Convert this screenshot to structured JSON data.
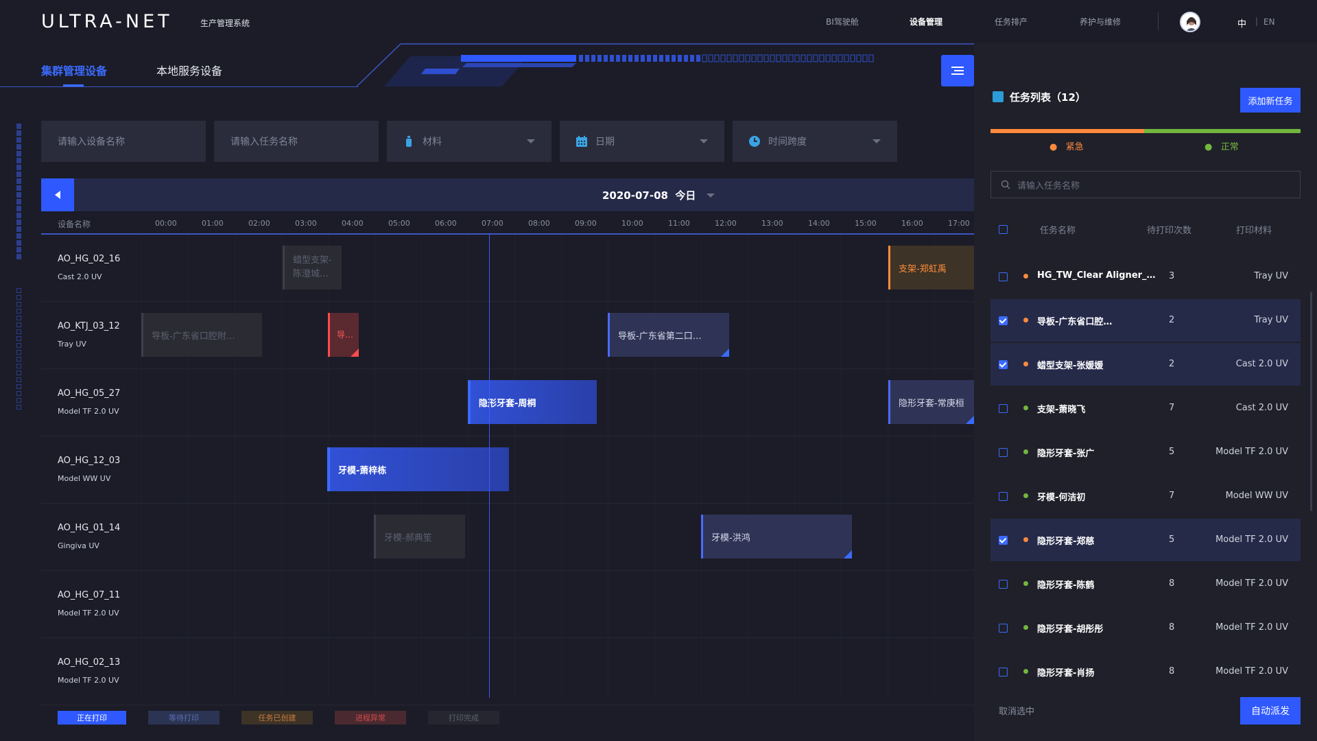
{
  "app": {
    "logo": "ULTRA-NET",
    "subtitle": "生产管理系统"
  },
  "topnav": [
    {
      "label": "BI驾驶舱"
    },
    {
      "label": "设备管理"
    },
    {
      "label": "任务排产"
    },
    {
      "label": "养护与维修"
    }
  ],
  "lang": {
    "zh": "中",
    "sep": "|",
    "en": "EN"
  },
  "tabs": [
    {
      "label": "集群管理设备"
    },
    {
      "label": "本地服务设备"
    }
  ],
  "filters": {
    "device_placeholder": "请输入设备名称",
    "task_placeholder": "请输入任务名称",
    "material": "材料",
    "date": "日期",
    "timespan": "时间跨度"
  },
  "datebar": {
    "date": "2020-07-08",
    "today": "今日"
  },
  "timeline": {
    "device_header": "设备名称",
    "hours": [
      "00:00",
      "01:00",
      "02:00",
      "03:00",
      "04:00",
      "05:00",
      "06:00",
      "07:00",
      "08:00",
      "09:00",
      "10:00",
      "11:00",
      "12:00",
      "13:00",
      "14:00",
      "15:00",
      "16:00",
      "17:00"
    ]
  },
  "devices": [
    {
      "name": "AO_HG_02_16",
      "type": "Cast 2.0 UV"
    },
    {
      "name": "AO_KTJ_03_12",
      "type": "Tray UV"
    },
    {
      "name": "AO_HG_05_27",
      "type": "Model TF 2.0 UV"
    },
    {
      "name": "AO_HG_12_03",
      "type": "Model WW UV"
    },
    {
      "name": "AO_HG_01_14",
      "type": "Gingiva UV"
    },
    {
      "name": "AO_HG_07_11",
      "type": "Model TF 2.0 UV"
    },
    {
      "name": "AO_HG_02_13",
      "type": "Model TF 2.0 UV"
    }
  ],
  "tasks": [
    {
      "label": "蜡型支架-陈澄城…",
      "status": "done"
    },
    {
      "label": "支架-郑虹禹",
      "status": "created"
    },
    {
      "label": "导板-广东省口腔附…",
      "status": "done"
    },
    {
      "label": "导…",
      "status": "error"
    },
    {
      "label": "导板-广东省第二口…",
      "status": "waiting"
    },
    {
      "label": "隐形牙套-周桐",
      "status": "printing"
    },
    {
      "label": "隐形牙套-常庚桓",
      "status": "waiting"
    },
    {
      "label": "牙模-萧梓栋",
      "status": "printing"
    },
    {
      "label": "牙模-郝典笙",
      "status": "done"
    },
    {
      "label": "牙模-洪鸿",
      "status": "waiting"
    }
  ],
  "legend": [
    {
      "label": "正在打印"
    },
    {
      "label": "等待打印"
    },
    {
      "label": "任务已创建"
    },
    {
      "label": "进程异常"
    },
    {
      "label": "打印完成"
    }
  ],
  "task_panel": {
    "title": "任务列表（12）",
    "add_button": "添加新任务",
    "urgent": "紧急",
    "normal": "正常",
    "search_placeholder": "请输入任务名称",
    "headers": {
      "name": "任务名称",
      "count": "待打印次数",
      "material": "打印材料"
    },
    "rows": [
      {
        "name": "HG_TW_Clear Aligner_…",
        "count": "3",
        "material": "Tray UV",
        "checked": false,
        "priority": "urgent"
      },
      {
        "name": "导板-广东省口腔…",
        "count": "2",
        "material": "Tray UV",
        "checked": true,
        "priority": "urgent"
      },
      {
        "name": "蜡型支架-张媛媛",
        "count": "2",
        "material": "Cast 2.0 UV",
        "checked": true,
        "priority": "urgent"
      },
      {
        "name": "支架-萧晓飞",
        "count": "7",
        "material": "Cast 2.0 UV",
        "checked": false,
        "priority": "normal"
      },
      {
        "name": "隐形牙套-张广",
        "count": "5",
        "material": "Model TF 2.0 UV",
        "checked": false,
        "priority": "normal"
      },
      {
        "name": "牙模-何洁初",
        "count": "7",
        "material": "Model WW UV",
        "checked": false,
        "priority": "normal"
      },
      {
        "name": "隐形牙套-郑慈",
        "count": "5",
        "material": "Model TF 2.0 UV",
        "checked": true,
        "priority": "urgent"
      },
      {
        "name": "隐形牙套-陈鹤",
        "count": "8",
        "material": "Model TF 2.0 UV",
        "checked": false,
        "priority": "normal"
      },
      {
        "name": "隐形牙套-胡彤彤",
        "count": "8",
        "material": "Model TF 2.0 UV",
        "checked": false,
        "priority": "normal"
      },
      {
        "name": "隐形牙套-肖扬",
        "count": "8",
        "material": "Model TF 2.0 UV",
        "checked": false,
        "priority": "normal"
      }
    ],
    "cancel": "取消选中",
    "auto_dispatch": "自动派发"
  },
  "colors": {
    "accent": "#2f59ff",
    "urgent": "#ff8a3d",
    "normal": "#73b63f",
    "error": "#ff4b4b"
  }
}
